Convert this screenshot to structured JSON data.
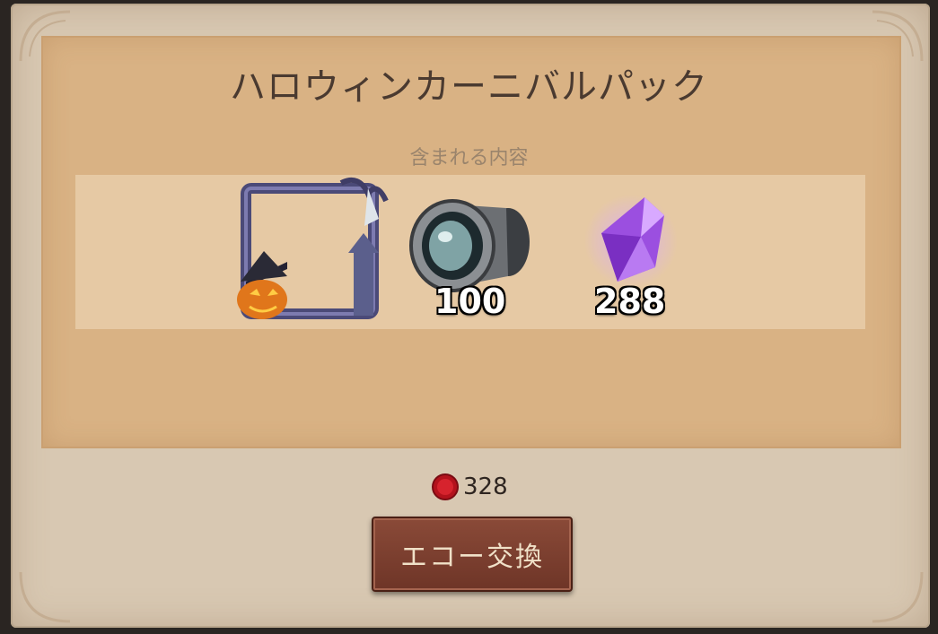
{
  "dialog": {
    "title": "ハロウィンカーニバルパック",
    "contents_label": "含まれる内容"
  },
  "items": [
    {
      "name": "Halloween avatar frame",
      "icon": "halloween-frame-icon",
      "count": ""
    },
    {
      "name": "Lens",
      "icon": "lens-icon",
      "count": "100"
    },
    {
      "name": "Purple crystal",
      "icon": "purple-crystal-icon",
      "count": "288"
    }
  ],
  "price": {
    "currency_icon": "red-seal-icon",
    "amount": "328"
  },
  "exchange_button": {
    "label": "エコー交換"
  },
  "colors": {
    "inner_panel": "#d9b284",
    "button": "#7a3d2f",
    "crystal": "#9b4fe0"
  }
}
